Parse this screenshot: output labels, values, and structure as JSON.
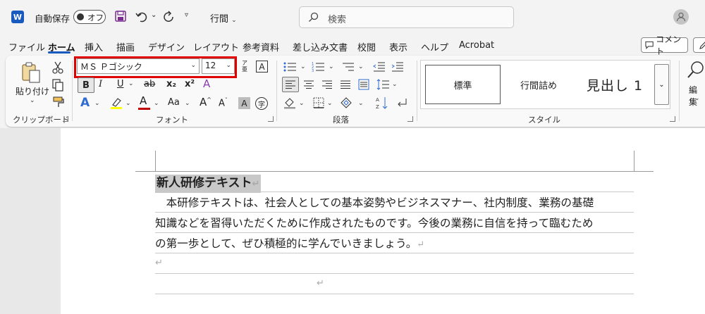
{
  "titlebar": {
    "app_icon": "W",
    "autosave_label": "自動保存",
    "autosave_toggle": "オフ",
    "style_qat": "行間",
    "search_placeholder": "検索"
  },
  "tabs": [
    "ファイル",
    "ホーム",
    "挿入",
    "描画",
    "デザイン",
    "レイアウト",
    "参考資料",
    "差し込み文書",
    "校閲",
    "表示",
    "ヘルプ",
    "Acrobat"
  ],
  "comment_button": "コメント",
  "clipboard": {
    "paste": "貼り付け",
    "group": "クリップボード"
  },
  "font": {
    "name": "ＭＳ Ｐゴシック",
    "size": "12",
    "group": "フォント",
    "phonetic": "ア亜",
    "border_char": "A",
    "bold": "B",
    "italic": "I",
    "underline": "U",
    "strike": "ab",
    "subscript": "x₂",
    "superscript": "x²",
    "clear_format": "A",
    "effect": "A",
    "font_color": "A",
    "change_case": "Aa",
    "grow": "A",
    "shrink": "A",
    "char_shading": "A",
    "enclose": "字"
  },
  "paragraph": {
    "group": "段落"
  },
  "styles": {
    "group": "スタイル",
    "items": [
      "標準",
      "行間詰め",
      "見出し 1"
    ]
  },
  "editing": {
    "label": "編集"
  },
  "document": {
    "title": "新人研修テキスト",
    "paragraph_lines": [
      "　本研修テキストは、社会人としての基本姿勢やビジネスマナー、社内制度、業務の基礎",
      "知識などを習得いただくために作成されたものです。今後の業務に自信を持って臨むため",
      "の第一歩として、ぜひ積極的に学んでいきましょう。"
    ],
    "return_mark": "↵"
  },
  "colors": {
    "accent": "#185abd",
    "highlight_box": "#e00000",
    "font_color_bar": "#c00000",
    "highlight_bar": "#ffff00"
  }
}
